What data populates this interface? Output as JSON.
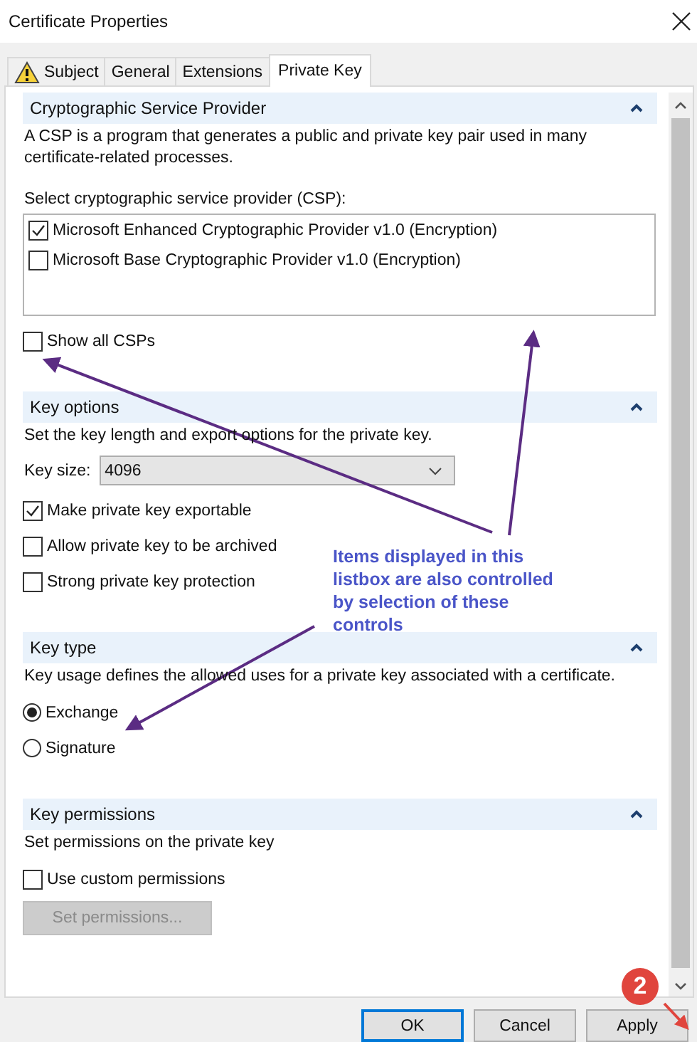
{
  "window": {
    "title": "Certificate Properties"
  },
  "tabs": [
    {
      "label": "Subject",
      "warning": true,
      "selected": false
    },
    {
      "label": "General",
      "warning": false,
      "selected": false
    },
    {
      "label": "Extensions",
      "warning": false,
      "selected": false
    },
    {
      "label": "Private Key",
      "warning": false,
      "selected": true
    }
  ],
  "sections": [
    {
      "title": "Cryptographic Service Provider",
      "expanded": true,
      "description": "A CSP is a program that generates a public and private key pair used in many certificate-related processes.",
      "controls": [
        {
          "kind": "label",
          "text": "Select cryptographic service provider (CSP):"
        },
        {
          "kind": "listbox",
          "items": [
            {
              "label": "Microsoft Enhanced Cryptographic Provider v1.0 (Encryption)",
              "checked": true
            },
            {
              "label": "Microsoft Base Cryptographic Provider v1.0 (Encryption)",
              "checked": false
            }
          ]
        },
        {
          "kind": "checkbox",
          "label": "Show all CSPs",
          "checked": false
        }
      ]
    },
    {
      "title": "Key options",
      "expanded": true,
      "description": "Set the key length and export options for the private key.",
      "controls": [
        {
          "kind": "dropdown",
          "label": "Key size:",
          "value": "4096"
        },
        {
          "kind": "checkbox",
          "label": "Make private key exportable",
          "checked": true
        },
        {
          "kind": "checkbox",
          "label": "Allow private key to be archived",
          "checked": false
        },
        {
          "kind": "checkbox",
          "label": "Strong private key protection",
          "checked": false
        }
      ]
    },
    {
      "title": "Key type",
      "expanded": true,
      "description": "Key usage defines the allowed uses for a private key associated with a certificate.",
      "controls": [
        {
          "kind": "radio",
          "label": "Exchange",
          "selected": true
        },
        {
          "kind": "radio",
          "label": "Signature",
          "selected": false
        }
      ]
    },
    {
      "title": "Key permissions",
      "expanded": true,
      "description": "Set permissions on the private key",
      "controls": [
        {
          "kind": "checkbox",
          "label": "Use custom permissions",
          "checked": false
        },
        {
          "kind": "button",
          "label": "Set permissions...",
          "disabled": true
        }
      ]
    }
  ],
  "annotation": {
    "text": "Items displayed in this listbox are also controlled by selection of these controls"
  },
  "step_badge": "2",
  "buttons": [
    {
      "label": "OK",
      "default": true
    },
    {
      "label": "Cancel",
      "default": false
    },
    {
      "label": "Apply",
      "default": false
    }
  ]
}
